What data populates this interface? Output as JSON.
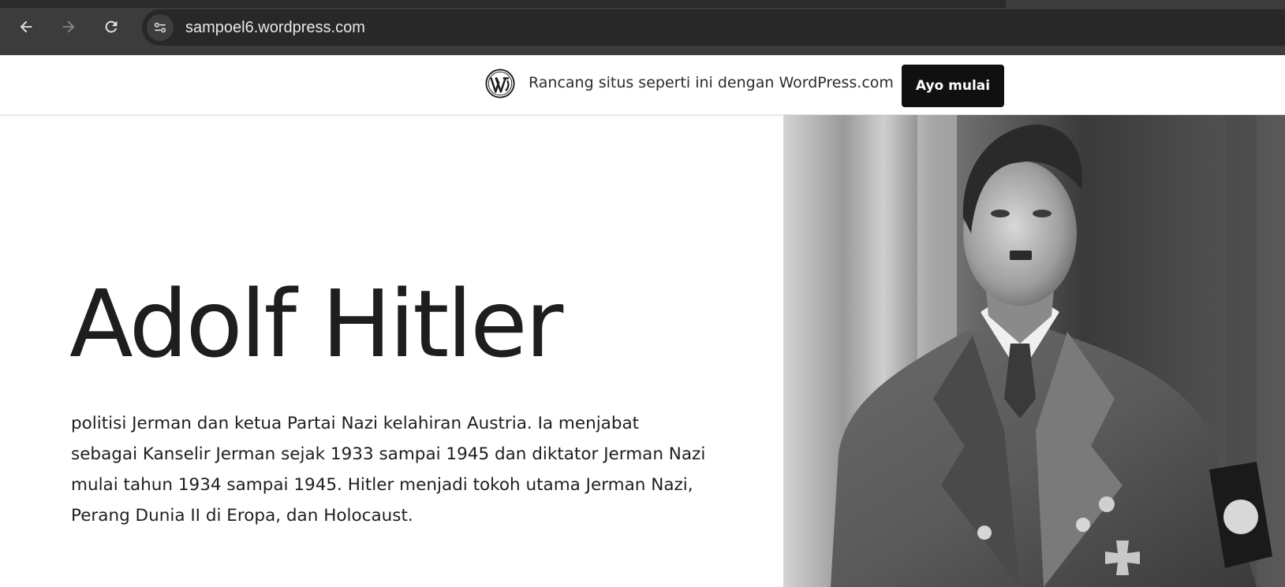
{
  "browser": {
    "url": "sampoel6.wordpress.com"
  },
  "banner": {
    "text": "Rancang situs seperti ini dengan WordPress.com",
    "button_label": "Ayo mulai"
  },
  "hero": {
    "title": "Adolf Hitler",
    "description": "politisi Jerman dan ketua Partai Nazi kelahiran Austria. Ia menjabat sebagai Kanselir Jerman sejak 1933 sampai 1945 dan diktator Jerman Nazi mulai tahun 1934 sampai 1945. Hitler menjadi tokoh utama Jerman Nazi, Perang Dunia II di Eropa, dan Holocaust."
  },
  "icons": {
    "back": "arrow-left-icon",
    "forward": "arrow-right-icon",
    "reload": "reload-icon",
    "site_info": "tune-icon",
    "wordpress": "wordpress-logo-icon"
  },
  "colors": {
    "toolbar": "#3c3c3c",
    "address_bar": "#282828",
    "button_bg": "#101010",
    "text": "#1e1e1e"
  }
}
